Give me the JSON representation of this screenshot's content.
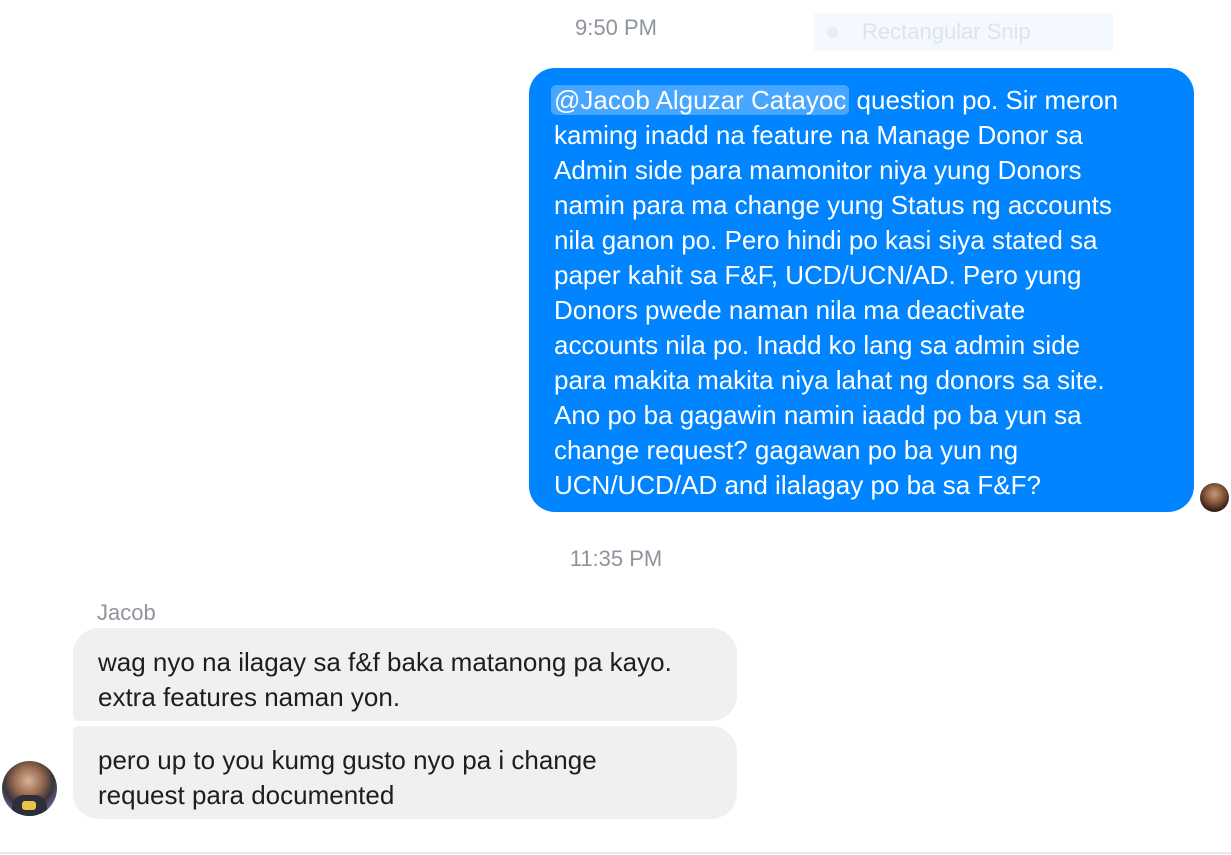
{
  "timestamps": [
    "9:50 PM",
    "11:35 PM"
  ],
  "snip_overlay": {
    "label": "Rectangular Snip"
  },
  "outgoing_message": {
    "mention": "@Jacob Alguzar Catayoc",
    "lines": [
      " question po. Sir meron",
      "kaming inadd na feature na Manage Donor sa",
      "Admin side para mamonitor niya yung Donors",
      "namin para ma change yung Status ng accounts",
      "nila ganon po. Pero hindi po kasi siya stated sa",
      "paper kahit sa F&F, UCD/UCN/AD. Pero yung",
      "Donors pwede naman nila ma deactivate",
      "accounts nila po. Inadd ko lang sa admin side",
      "para makita makita niya lahat ng donors sa site.",
      "Ano po ba gagawin namin iaadd po ba yun sa",
      "change request? gagawan po ba yun ng",
      "UCN/UCD/AD and ilalagay po ba sa F&F?"
    ]
  },
  "incoming": {
    "sender_name": "Jacob",
    "messages": [
      {
        "lines": [
          "wag nyo na ilagay sa f&f baka matanong pa kayo.",
          "extra features naman yon."
        ]
      },
      {
        "lines": [
          "pero up to you kumg gusto nyo pa i change",
          "request para documented"
        ]
      }
    ]
  },
  "colors": {
    "outgoing_bubble": "#0084ff",
    "incoming_bubble": "#f1f0f0",
    "timestamp_text": "#8d949e"
  }
}
